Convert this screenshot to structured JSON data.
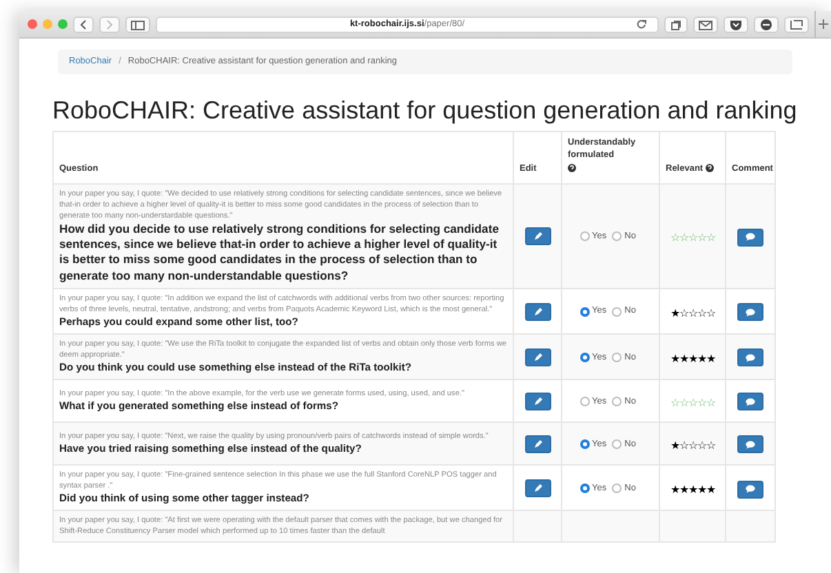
{
  "browser": {
    "url_host": "kt-robochair.ijs.si",
    "url_path": "/paper/80/"
  },
  "breadcrumb": {
    "separator": "/",
    "items": [
      {
        "label": "RoboChair",
        "link": true
      },
      {
        "label": "RoboCHAIR: Creative assistant for question generation and ranking",
        "link": false
      }
    ]
  },
  "title": "RoboCHAIR: Creative assistant for question generation and ranking",
  "columns": [
    {
      "label": "Question",
      "help": false
    },
    {
      "label": "Edit",
      "help": false
    },
    {
      "label": "Understandably formulated",
      "help": true
    },
    {
      "label": "Relevant",
      "help": true
    },
    {
      "label": "Comment",
      "help": false
    }
  ],
  "rows": [
    {
      "quote": "In your paper you say, I quote: \"We decided to use relatively strong conditions for selecting candidate sentences, since we believe that-in order to achieve a higher level of quality-it is better to miss some good candidates in the process of selection than to generate too many non-understardable questions.\"",
      "question": "How did you decide to use relatively strong conditions for selecting candidate sentences, since we believe that-in order to achieve a higher level of quality-it is better to miss some good candidates in the process of selection than to generate too many non-understandable questions?",
      "large": true,
      "options": [
        {
          "label": "Yes",
          "selected": false
        },
        {
          "label": "No",
          "selected": false
        }
      ],
      "stars": 0
    },
    {
      "quote": "In your paper you say, I quote: \"In addition we expand the list of catchwords with additional verbs from two other sources: reporting verbs of three levels, neutral, tentative, andstrong; and verbs from Paquots Academic Keyword List, which is the most general.\"",
      "question": "Perhaps you could expand some other list, too?",
      "large": false,
      "options": [
        {
          "label": "Yes",
          "selected": true
        },
        {
          "label": "No",
          "selected": false
        }
      ],
      "stars": 1
    },
    {
      "quote": "In your paper you say, I quote: \"We use the RiTa toolkit to conjugate the expanded list of verbs and obtain only those verb forms we deem appropriate.\"",
      "question": "Do you think you could use something else instead of the RiTa toolkit?",
      "large": false,
      "options": [
        {
          "label": "Yes",
          "selected": true
        },
        {
          "label": "No",
          "selected": false
        }
      ],
      "stars": 5
    },
    {
      "quote": "In your paper you say, I quote: \"In the above example, for the verb use we generate forms used, using, used, and use.\"",
      "question": "What if you generated something else instead of forms?",
      "large": false,
      "options": [
        {
          "label": "Yes",
          "selected": false
        },
        {
          "label": "No",
          "selected": false
        }
      ],
      "stars": 0
    },
    {
      "quote": "In your paper you say, I quote: \"Next, we raise the quality by using pronoun/verb pairs of catchwords instead of simple words.\"",
      "question": "Have you tried raising something else instead of the quality?",
      "large": false,
      "options": [
        {
          "label": "Yes",
          "selected": true
        },
        {
          "label": "No",
          "selected": false
        }
      ],
      "stars": 1
    },
    {
      "quote": "In your paper you say, I quote: \"Fine-grained sentence selection In this phase we use the full Stanford CoreNLP POS tagger and syntax parser .\"",
      "question": "Did you think of using some other tagger instead?",
      "large": false,
      "options": [
        {
          "label": "Yes",
          "selected": true
        },
        {
          "label": "No",
          "selected": false
        }
      ],
      "stars": 5
    },
    {
      "quote": "In your paper you say, I quote: \"At first we were operating with the default parser that comes with the package, but we changed for Shift-Reduce Constituency Parser model which performed up to 10 times faster than the default"
    }
  ]
}
